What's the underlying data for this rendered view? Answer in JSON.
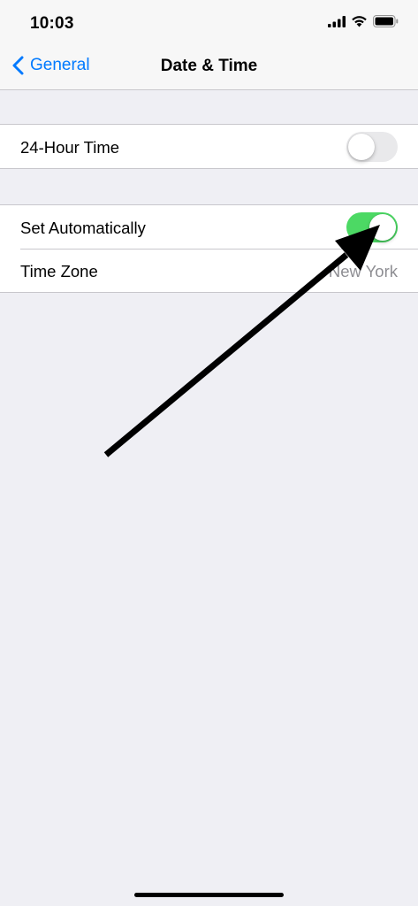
{
  "status_bar": {
    "time": "10:03",
    "icons": [
      "cellular-signal-icon",
      "wifi-icon",
      "battery-icon"
    ]
  },
  "nav": {
    "back_label": "General",
    "title": "Date & Time"
  },
  "groups": [
    {
      "rows": [
        {
          "label": "24-Hour Time",
          "control": "toggle",
          "on": false
        }
      ]
    },
    {
      "rows": [
        {
          "label": "Set Automatically",
          "control": "toggle",
          "on": true
        },
        {
          "label": "Time Zone",
          "value": "New York"
        }
      ]
    }
  ],
  "colors": {
    "accent": "#007aff",
    "toggle_on": "#4cd964",
    "toggle_off": "#e9e9eb",
    "background": "#efeff4",
    "secondary_text": "#8e8e93"
  },
  "annotation": {
    "type": "arrow",
    "color": "#000000",
    "points_to": "set-automatically-toggle"
  }
}
